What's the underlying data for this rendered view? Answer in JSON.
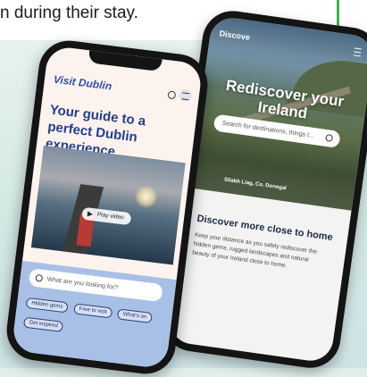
{
  "intro": {
    "text": "n during their stay."
  },
  "right_phone": {
    "top_nav_label": "Discove",
    "hero_title_line1": "Rediscover your",
    "hero_title_line2": "Ireland",
    "search_placeholder": "Search for destinations, things t...",
    "hero_caption": "Sliabh Liag, Co. Donegal",
    "section_heading": "Discover more close to home",
    "section_body": "Keep your distance as you safely rediscover the hidden gems, rugged landscapes and natural beauty of your Ireland close to home."
  },
  "left_phone": {
    "logo_text": "Visit Dublin",
    "heading": "Your guide to a perfect Dublin experience",
    "play_label": "Play video",
    "search_placeholder": "What are you looking for?",
    "chips": [
      "Hidden gems",
      "Free to visit",
      "What's on",
      "Get inspired"
    ]
  },
  "colors": {
    "accent_blue": "#213e8f",
    "accent_green": "#3fb44a",
    "bottom_panel": "#a8c0e6"
  }
}
